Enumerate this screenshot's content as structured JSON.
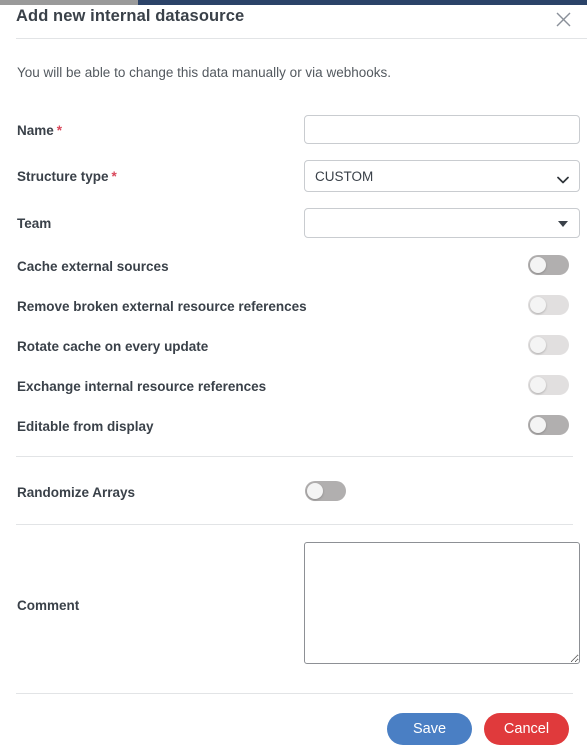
{
  "modal": {
    "title": "Add new internal datasource",
    "close_icon": "close-icon",
    "intro": "You will be able to change this data manually or via webhooks."
  },
  "form": {
    "name": {
      "label": "Name",
      "required_marker": "*",
      "value": "",
      "placeholder": ""
    },
    "structure_type": {
      "label": "Structure type",
      "required_marker": "*",
      "selected": "CUSTOM",
      "options": [
        "CUSTOM"
      ],
      "caret_icon": "chevron-down-icon"
    },
    "team": {
      "label": "Team",
      "selected": "",
      "caret_icon": "caret-down-icon"
    },
    "toggles": [
      {
        "label": "Cache external sources",
        "state": "off",
        "tone": "dark"
      },
      {
        "label": "Remove broken external resource references",
        "state": "off",
        "tone": "light"
      },
      {
        "label": "Rotate cache on every update",
        "state": "off",
        "tone": "light"
      },
      {
        "label": "Exchange internal resource references",
        "state": "off",
        "tone": "light"
      },
      {
        "label": "Editable from display",
        "state": "off",
        "tone": "dark"
      }
    ],
    "randomize": {
      "label": "Randomize Arrays",
      "state": "off",
      "tone": "dark"
    },
    "comment": {
      "label": "Comment",
      "value": "",
      "placeholder": ""
    }
  },
  "footer": {
    "save_label": "Save",
    "cancel_label": "Cancel"
  },
  "colors": {
    "accent_save": "#4a7fc4",
    "accent_cancel": "#e03a3c",
    "required_star": "#d9475a",
    "app_header": "#2b4368",
    "label_text": "#3a4149",
    "border": "#c9ccd0",
    "divider": "#e2e4e6",
    "toggle_dark": "#b1afaf",
    "toggle_light": "#e1dfdf"
  }
}
